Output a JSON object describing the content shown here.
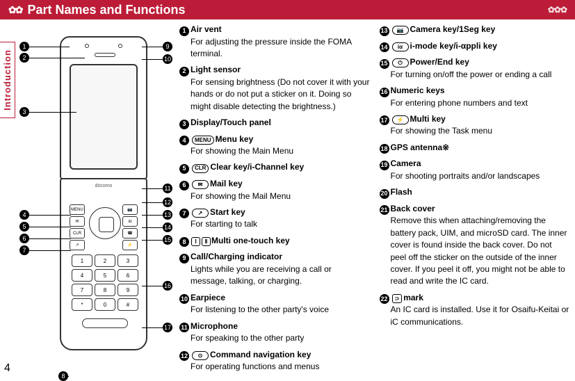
{
  "header": {
    "title": "Part Names and Functions"
  },
  "side_tab": "Introduction",
  "page_number": "4",
  "phone": {
    "brand": "döcomo",
    "nav_center": "□/AF"
  },
  "keypad": [
    "1",
    "2",
    "3",
    "4",
    "5",
    "6",
    "7",
    "8",
    "9",
    "*",
    "0",
    "#"
  ],
  "side_keys_left": [
    "MENU",
    "✉",
    "CLR",
    "↗"
  ],
  "side_keys_right": [
    "📷",
    "iα",
    "☎",
    "⚡"
  ],
  "callouts": {
    "c1": "1",
    "c2": "2",
    "c3": "3",
    "c4": "4",
    "c5": "5",
    "c6": "6",
    "c7": "7",
    "c8": "8",
    "c9": "9",
    "c10": "10",
    "c11": "11",
    "c12": "12",
    "c13": "13",
    "c14": "14",
    "c15": "15",
    "c16": "16",
    "c17": "17"
  },
  "items": [
    {
      "num": "1",
      "head": "Air vent",
      "key": "",
      "body": "For adjusting the pressure inside the FOMA terminal."
    },
    {
      "num": "2",
      "head": "Light sensor",
      "key": "",
      "body": "For sensing brightness (Do not cover it with your hands or do not put a sticker on it. Doing so might disable detecting the brightness.)"
    },
    {
      "num": "3",
      "head": "Display/Touch panel",
      "key": "",
      "body": ""
    },
    {
      "num": "4",
      "head": "Menu key",
      "key": "MENU",
      "body": "For showing the Main Menu"
    },
    {
      "num": "5",
      "head": "Clear key/i-Channel key",
      "key": "CLR",
      "body": ""
    },
    {
      "num": "6",
      "head": "Mail key",
      "key": "✉",
      "body": "For showing the Mail Menu"
    },
    {
      "num": "7",
      "head": "Start key",
      "key": "↗",
      "body": "For starting to talk"
    },
    {
      "num": "8",
      "head": "Multi one-touch key",
      "key": "",
      "body": "",
      "squares": [
        "Ⅰ",
        "Ⅱ"
      ]
    },
    {
      "num": "9",
      "head": "Call/Charging indicator",
      "key": "",
      "body": "Lights while you are receiving a call or message, talking, or charging."
    },
    {
      "num": "10",
      "head": "Earpiece",
      "key": "",
      "body": "For listening to the other party's voice"
    },
    {
      "num": "11",
      "head": "Microphone",
      "key": "",
      "body": "For speaking to the other party"
    },
    {
      "num": "12",
      "head": "Command navigation key",
      "key": "⊙",
      "body": "For operating functions and menus"
    },
    {
      "num": "13",
      "head": "Camera key/1Seg key",
      "key": "📷",
      "body": ""
    },
    {
      "num": "14",
      "head": "i-mode key/i-αppli key",
      "key": "iα",
      "body": ""
    },
    {
      "num": "15",
      "head": "Power/End key",
      "key": "⏻",
      "body": "For turning on/off the power or ending a call"
    },
    {
      "num": "16",
      "head": "Numeric keys",
      "key": "",
      "body": "For entering phone numbers and text"
    },
    {
      "num": "17",
      "head": "Multi key",
      "key": "⚡",
      "body": "For showing the Task menu"
    },
    {
      "num": "18",
      "head": "GPS antenna※",
      "key": "",
      "body": ""
    },
    {
      "num": "19",
      "head": "Camera",
      "key": "",
      "body": "For shooting portraits and/or landscapes"
    },
    {
      "num": "20",
      "head": "Flash",
      "key": "",
      "body": ""
    },
    {
      "num": "21",
      "head": "Back cover",
      "key": "",
      "body": "Remove this when attaching/removing the battery pack, UIM, and microSD card. The inner cover is found inside the back cover. Do not peel off the sticker on the outside of the inner cover. If you peel it off, you might not be able to read and write the IC card."
    },
    {
      "num": "22",
      "head": "mark",
      "key": "",
      "body": "An IC card is installed. Use it for Osaifu-Keitai or iC communications.",
      "felica": "⊃"
    }
  ]
}
